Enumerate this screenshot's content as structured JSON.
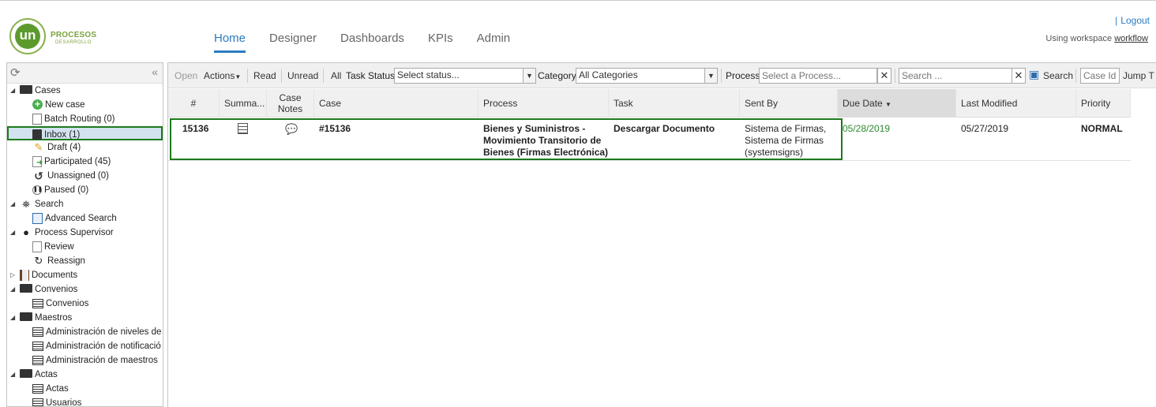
{
  "header": {
    "logo_text": "un",
    "logo_ring": "UNIVERSIDAD NACIONAL DE COLOMBIA",
    "brand_title": "PROCESOS",
    "brand_sub": "DESARROLLO",
    "nav": [
      "Home",
      "Designer",
      "Dashboards",
      "KPIs",
      "Admin"
    ],
    "active_nav": "Home",
    "logout_sep": "|",
    "logout": "Logout",
    "workspace_prefix": "Using workspace",
    "workspace_name": "workflow"
  },
  "sidebar": {
    "refresh_icon": "refresh-icon",
    "collapse": "«",
    "cases_label": "Cases",
    "new_case": "New case",
    "batch_routing": "Batch Routing (0)",
    "inbox": "Inbox (1)",
    "draft": "Draft (4)",
    "participated": "Participated (45)",
    "unassigned": "Unassigned (0)",
    "paused": "Paused (0)",
    "search_label": "Search",
    "advanced_search": "Advanced Search",
    "process_supervisor": "Process Supervisor",
    "review": "Review",
    "reassign": "Reassign",
    "documents": "Documents",
    "convenios_folder": "Convenios",
    "convenios_item": "Convenios",
    "maestros_folder": "Maestros",
    "maestros_items": [
      "Administración de niveles de",
      "Administración de notificació",
      "Administración de maestros"
    ],
    "actas_folder": "Actas",
    "actas_item": "Actas",
    "usuarios_item": "Usuarios"
  },
  "toolbar": {
    "open": "Open",
    "actions": "Actions",
    "read": "Read",
    "unread": "Unread",
    "all": "All",
    "task_status_label": "Task Status",
    "task_status_value": "Select status...",
    "category_label": "Category",
    "category_value": "All Categories",
    "process_label": "Process",
    "process_placeholder": "Select a Process...",
    "search_placeholder": "Search ...",
    "search_button": "Search",
    "caseid_placeholder": "Case Id",
    "jump": "Jump T"
  },
  "table": {
    "columns": {
      "num": "#",
      "summary": "Summa...",
      "notes_l1": "Case",
      "notes_l2": "Notes",
      "case": "Case",
      "process": "Process",
      "task": "Task",
      "sent_by": "Sent By",
      "due_date": "Due Date",
      "last_modified": "Last Modified",
      "priority": "Priority"
    },
    "row": {
      "num": "15136",
      "case": "#15136",
      "process_l1": "Bienes y Suministros -",
      "process_l2": "Movimiento Transitorio de",
      "process_l3": "Bienes (Firmas Electrónica)",
      "task": "Descargar Documento",
      "sent_l1": "Sistema de Firmas,",
      "sent_l2": "Sistema de Firmas",
      "sent_l3": "(systemsigns)",
      "due_date": "05/28/2019",
      "last_modified": "05/27/2019",
      "priority": "NORMAL"
    }
  }
}
